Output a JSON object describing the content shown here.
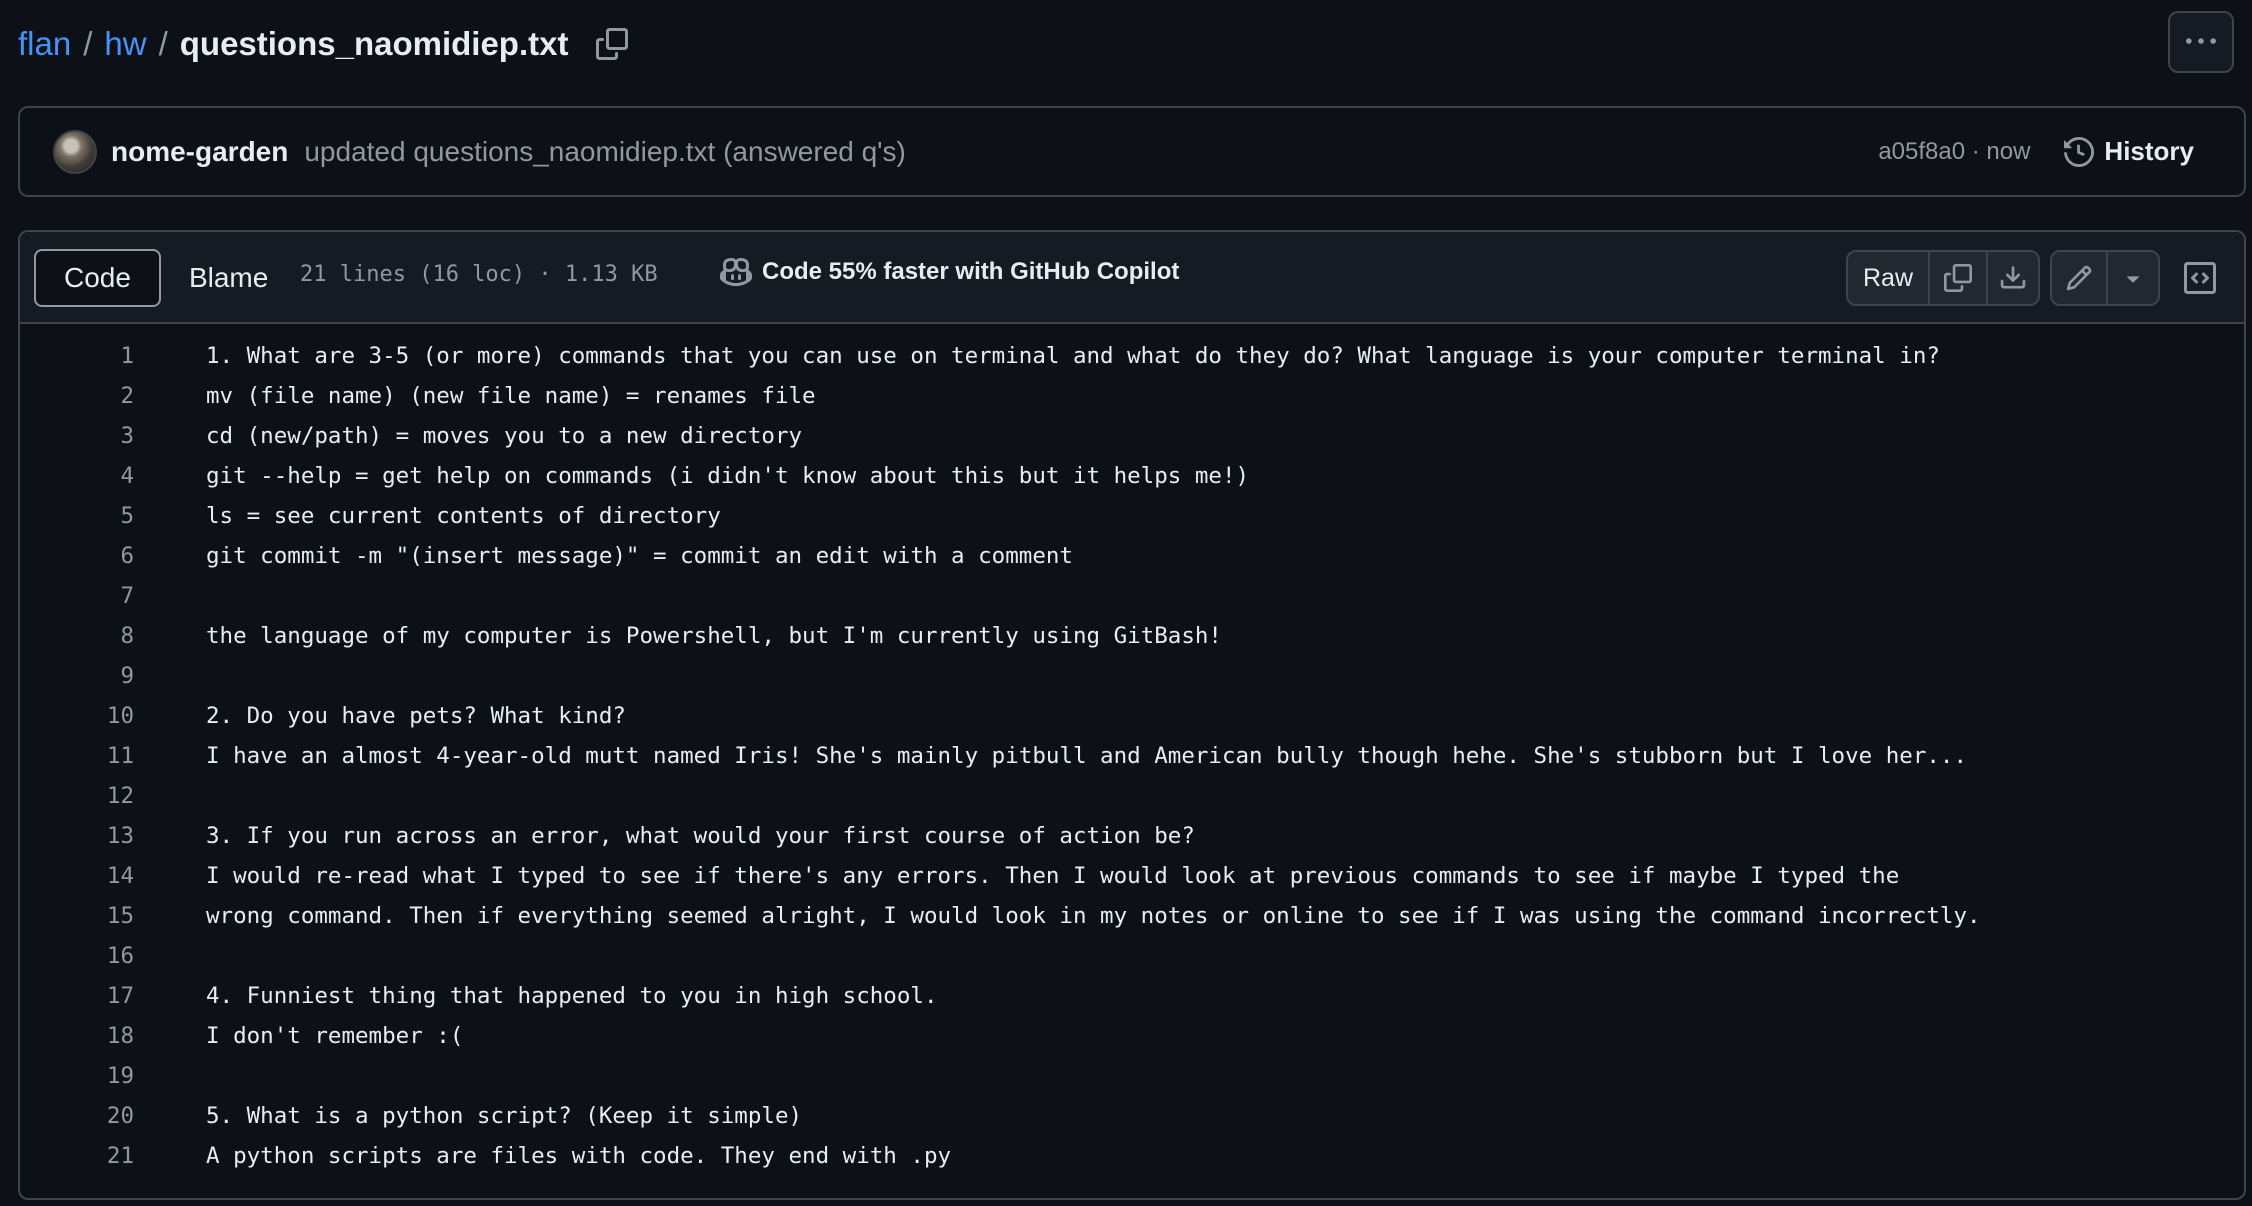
{
  "breadcrumb": {
    "repo": "flan",
    "folder": "hw",
    "separator": "/",
    "file": "questions_naomidiep.txt",
    "copy_icon": "copy-icon"
  },
  "more_button": {
    "icon": "kebab-horizontal-icon"
  },
  "commit": {
    "author": "nome-garden",
    "message": "updated questions_naomidiep.txt (answered q's)",
    "meta": "a05f8a0 · now",
    "history_label": "History",
    "history_icon": "history-icon"
  },
  "file_header": {
    "tabs": [
      "Code",
      "Blame"
    ],
    "active_tab": "Code",
    "stats": "21 lines (16 loc) · 1.13 KB",
    "copilot_label": "Code 55% faster with GitHub Copilot",
    "raw_label": "Raw"
  },
  "colors": {
    "background": "#0d1117",
    "header_bg": "#151b23",
    "border": "#3d444d",
    "link": "#4493f8",
    "muted": "#9198a1",
    "text": "#e6edf3"
  },
  "lines": [
    {
      "n": "1",
      "text": "1. What are 3-5 (or more) commands that you can use on terminal and what do they do? What language is your computer terminal in?"
    },
    {
      "n": "2",
      "text": "mv (file name) (new file name) = renames file"
    },
    {
      "n": "3",
      "text": "cd (new/path) = moves you to a new directory"
    },
    {
      "n": "4",
      "text": "git --help = get help on commands (i didn't know about this but it helps me!)"
    },
    {
      "n": "5",
      "text": "ls = see current contents of directory"
    },
    {
      "n": "6",
      "text": "git commit -m \"(insert message)\" = commit an edit with a comment"
    },
    {
      "n": "7",
      "text": ""
    },
    {
      "n": "8",
      "text": "the language of my computer is Powershell, but I'm currently using GitBash!"
    },
    {
      "n": "9",
      "text": ""
    },
    {
      "n": "10",
      "text": "2. Do you have pets? What kind?"
    },
    {
      "n": "11",
      "text": "I have an almost 4-year-old mutt named Iris! She's mainly pitbull and American bully though hehe. She's stubborn but I love her..."
    },
    {
      "n": "12",
      "text": ""
    },
    {
      "n": "13",
      "text": "3. If you run across an error, what would your first course of action be?"
    },
    {
      "n": "14",
      "text": "I would re-read what I typed to see if there's any errors. Then I would look at previous commands to see if maybe I typed the"
    },
    {
      "n": "15",
      "text": "wrong command. Then if everything seemed alright, I would look in my notes or online to see if I was using the command incorrectly."
    },
    {
      "n": "16",
      "text": ""
    },
    {
      "n": "17",
      "text": "4. Funniest thing that happened to you in high school."
    },
    {
      "n": "18",
      "text": "I don't remember :("
    },
    {
      "n": "19",
      "text": ""
    },
    {
      "n": "20",
      "text": "5. What is a python script? (Keep it simple)"
    },
    {
      "n": "21",
      "text": "A python scripts are files with code. They end with .py"
    }
  ]
}
